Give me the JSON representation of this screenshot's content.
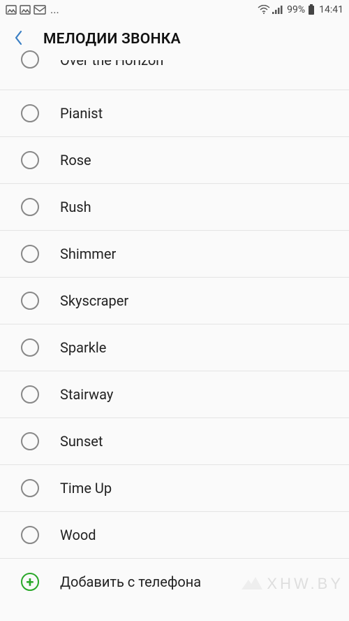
{
  "status_bar": {
    "battery_percent": "99%",
    "time": "14:41",
    "ellipsis": "..."
  },
  "header": {
    "title": "МЕЛОДИИ ЗВОНКА"
  },
  "ringtones": [
    {
      "label": "Over the Horizon",
      "selected": false,
      "cut": true
    },
    {
      "label": "Pianist",
      "selected": false
    },
    {
      "label": "Rose",
      "selected": false
    },
    {
      "label": "Rush",
      "selected": false
    },
    {
      "label": "Shimmer",
      "selected": false
    },
    {
      "label": "Skyscraper",
      "selected": false
    },
    {
      "label": "Sparkle",
      "selected": false
    },
    {
      "label": "Stairway",
      "selected": false
    },
    {
      "label": "Sunset",
      "selected": false
    },
    {
      "label": "Time Up",
      "selected": false
    },
    {
      "label": "Wood",
      "selected": false
    }
  ],
  "add_row": {
    "label": "Добавить с телефона"
  },
  "watermark": {
    "text": "XHW.BY"
  }
}
